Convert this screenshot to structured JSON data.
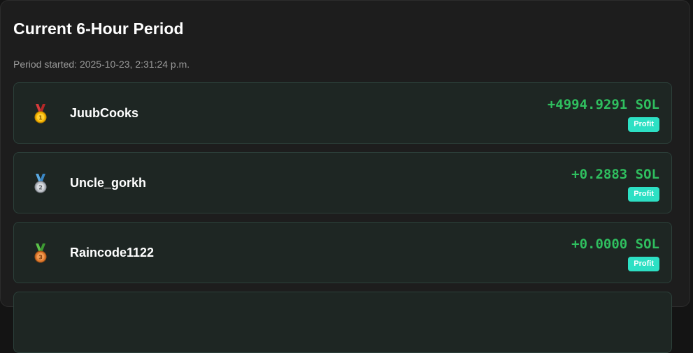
{
  "header": {
    "title": "Current 6-Hour Period",
    "period_started": "Period started: 2025-10-23, 2:31:24 p.m."
  },
  "colors": {
    "profit_text": "#2fbf5f",
    "badge_bg": "#2de0c4",
    "row_bg": "#1e2623"
  },
  "entries": [
    {
      "rank": "1",
      "medal": "gold-medal-icon",
      "name": "JuubCooks",
      "amount": "+4994.9291 SOL",
      "badge": "Profit"
    },
    {
      "rank": "2",
      "medal": "silver-medal-icon",
      "name": "Uncle_gorkh",
      "amount": "+0.2883 SOL",
      "badge": "Profit"
    },
    {
      "rank": "3",
      "medal": "bronze-medal-icon",
      "name": "Raincode1122",
      "amount": "+0.0000 SOL",
      "badge": "Profit"
    }
  ]
}
